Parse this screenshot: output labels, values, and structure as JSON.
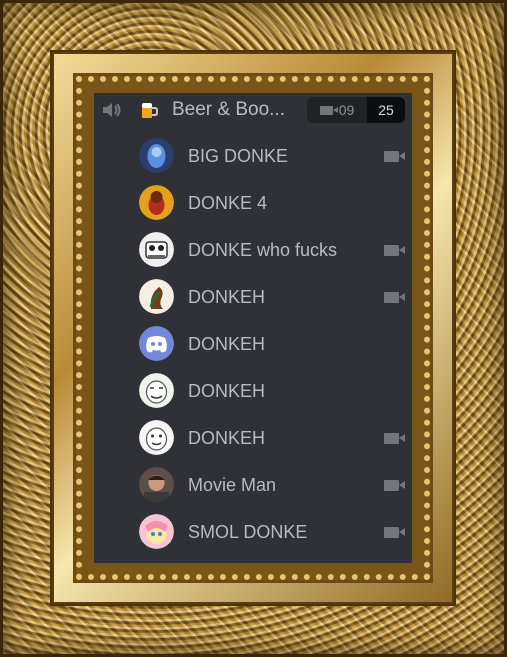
{
  "channel": {
    "name": "Beer & Boo...",
    "icon": "beer-mug-emoji",
    "current_count": "09",
    "limit": "25"
  },
  "members": [
    {
      "name": "BIG DONKE",
      "video": true,
      "avatar_color": "#3b6fc2"
    },
    {
      "name": "DONKE 4",
      "video": false,
      "avatar_color": "#e0a020"
    },
    {
      "name": "DONKE who fucks",
      "video": true,
      "avatar_color": "#e8e8e8"
    },
    {
      "name": "DONKEH",
      "video": true,
      "avatar_color": "#f2ede6"
    },
    {
      "name": "DONKEH",
      "video": false,
      "avatar_color": "#7289da"
    },
    {
      "name": "DONKEH",
      "video": false,
      "avatar_color": "#f0f5ef"
    },
    {
      "name": "DONKEH",
      "video": true,
      "avatar_color": "#f4f4f4"
    },
    {
      "name": "Movie Man",
      "video": true,
      "avatar_color": "#5a4a44"
    },
    {
      "name": "SMOL DONKE",
      "video": true,
      "avatar_color": "#f3b6c8"
    }
  ],
  "colors": {
    "panel_bg": "#2f3136",
    "text_muted": "#b9bbbe",
    "icon_gray": "#72767d",
    "frame_gold": "#b88a37"
  }
}
